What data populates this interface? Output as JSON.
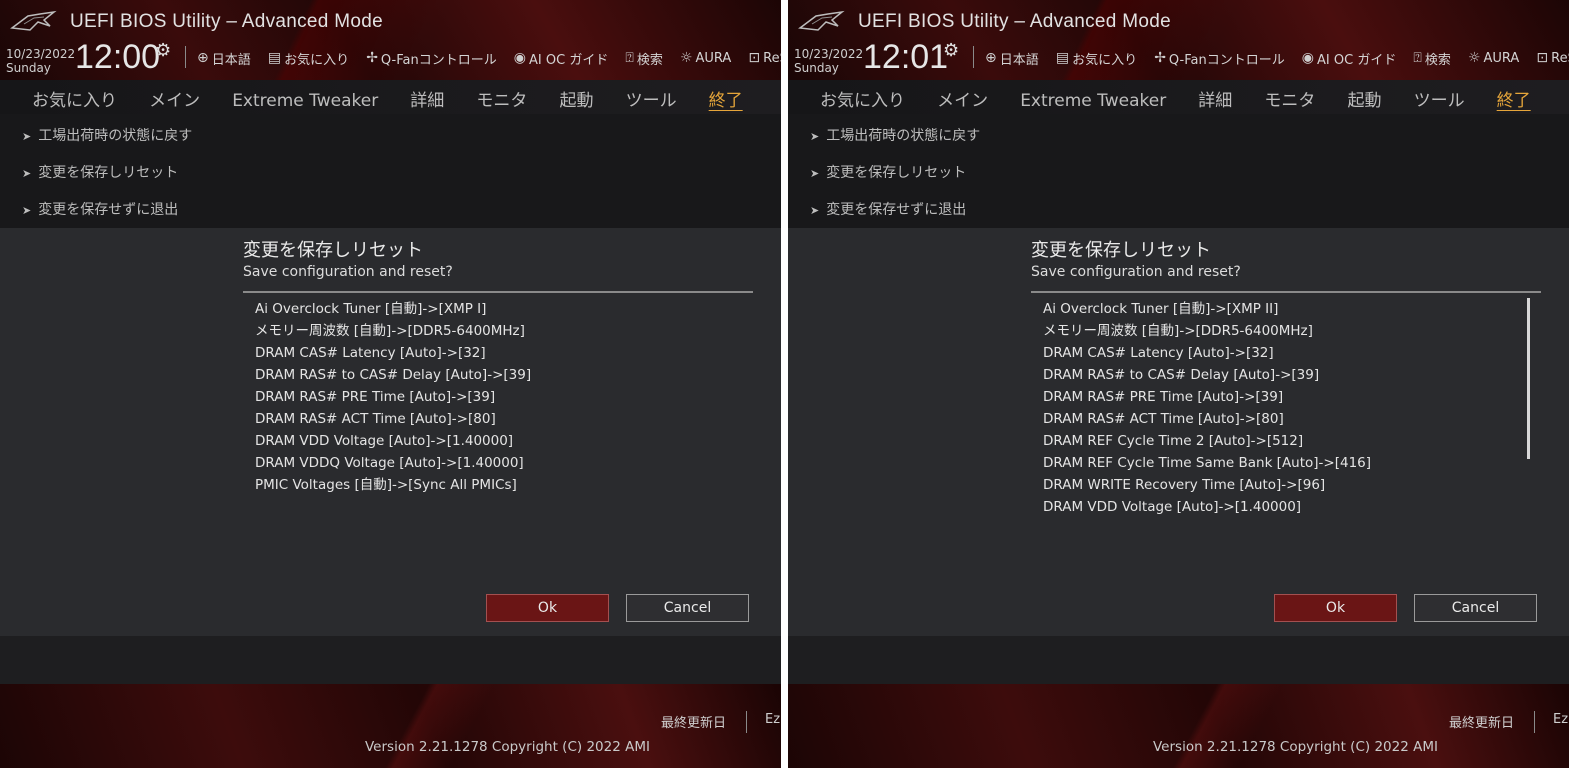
{
  "header": {
    "title": "UEFI BIOS Utility – Advanced Mode",
    "date": "10/23/2022",
    "day": "Sunday",
    "toolbar": [
      {
        "icon": "globe-icon",
        "label": "日本語"
      },
      {
        "icon": "favorites-icon",
        "label": "お気に入り"
      },
      {
        "icon": "fan-icon",
        "label": "Q-Fanコントロール"
      },
      {
        "icon": "ai-oc-icon",
        "label": "AI OC ガイド"
      },
      {
        "icon": "help-search-icon",
        "label": "検索"
      },
      {
        "icon": "aura-icon",
        "label": "AURA"
      },
      {
        "icon": "resize-bar-icon",
        "label": "ReS"
      }
    ]
  },
  "menu": {
    "tabs": [
      "お気に入り",
      "メイン",
      "Extreme Tweaker",
      "詳細",
      "モニタ",
      "起動",
      "ツール",
      "終了"
    ],
    "active": "終了"
  },
  "exit_items": [
    "工場出荷時の状態に戻す",
    "変更を保存しリセット",
    "変更を保存せずに退出"
  ],
  "dialog": {
    "title": "変更を保存しリセット",
    "subtitle": "Save configuration and reset?",
    "ok_label": "Ok",
    "cancel_label": "Cancel"
  },
  "panes": [
    {
      "time": "12:00",
      "changes": [
        "Ai Overclock Tuner [自動]->[XMP I]",
        "メモリー周波数 [自動]->[DDR5-6400MHz]",
        "DRAM CAS# Latency [Auto]->[32]",
        "DRAM RAS# to CAS# Delay [Auto]->[39]",
        "DRAM RAS# PRE Time [Auto]->[39]",
        "DRAM RAS# ACT Time [Auto]->[80]",
        "DRAM VDD Voltage [Auto]->[1.40000]",
        "DRAM VDDQ Voltage [Auto]->[1.40000]",
        "PMIC Voltages [自動]->[Sync All PMICs]"
      ]
    },
    {
      "time": "12:01",
      "changes": [
        "Ai Overclock Tuner [自動]->[XMP II]",
        "メモリー周波数 [自動]->[DDR5-6400MHz]",
        "DRAM CAS# Latency [Auto]->[32]",
        "DRAM RAS# to CAS# Delay [Auto]->[39]",
        "DRAM RAS# PRE Time [Auto]->[39]",
        "DRAM RAS# ACT Time [Auto]->[80]",
        "DRAM REF Cycle Time 2 [Auto]->[512]",
        "DRAM REF Cycle Time Same Bank [Auto]->[416]",
        "DRAM WRITE Recovery Time [Auto]->[96]",
        "DRAM VDD Voltage [Auto]->[1.40000]"
      ]
    }
  ],
  "footer": {
    "last_modified": "最終更新日",
    "ez_mode": "Ez",
    "version": "Version 2.21.1278 Copyright (C) 2022 AMI"
  },
  "colors": {
    "accent": "#e5a53a",
    "ok_button": "#6a1515",
    "dialog_bg": "#2a2b2e"
  }
}
